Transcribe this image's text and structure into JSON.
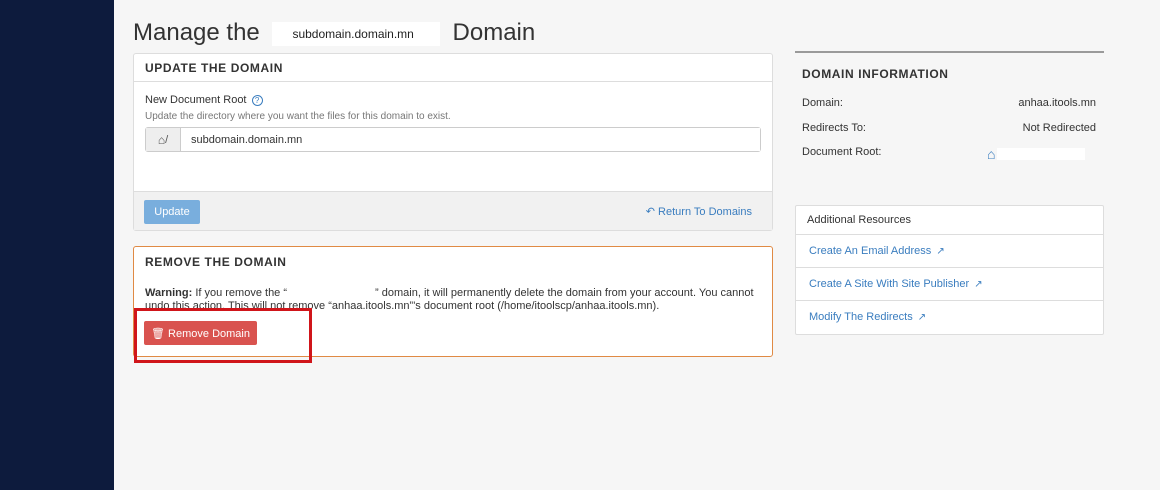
{
  "page": {
    "title_prefix": "Manage the",
    "title_domain": "subdomain.domain.mn",
    "title_suffix": "Domain"
  },
  "update_panel": {
    "heading": "UPDATE THE DOMAIN",
    "label": "New Document Root",
    "help": "Update the directory where you want the files for this domain to exist.",
    "addon": "/",
    "value": "subdomain.domain.mn",
    "update_button": "Update",
    "return_link": "Return To Domains"
  },
  "remove_panel": {
    "heading": "REMOVE THE DOMAIN",
    "warning_label": "Warning:",
    "warning_part1": "If you remove the “",
    "warning_part2": "” domain, it will permanently delete the domain from your account. You cannot undo this action. This will not remove “anhaa.itools.mn”'s document root (/home/itoolscp/anhaa.itools.mn).",
    "remove_button": "Remove Domain"
  },
  "domain_info": {
    "heading": "DOMAIN INFORMATION",
    "rows": [
      {
        "label": "Domain:",
        "value": "anhaa.itools.mn"
      },
      {
        "label": "Redirects To:",
        "value": "Not Redirected"
      },
      {
        "label": "Document Root:",
        "value": ""
      }
    ]
  },
  "resources": {
    "heading": "Additional Resources",
    "links": [
      {
        "label": "Create An Email Address"
      },
      {
        "label": "Create A Site With Site Publisher"
      },
      {
        "label": "Modify The Redirects"
      }
    ]
  },
  "icons": {
    "help": "question-circle-icon",
    "home": "home-icon",
    "return": "reply-arrow-icon",
    "trash": "trash-icon",
    "external": "external-link-icon"
  },
  "colors": {
    "sidebar": "#0d1b3d",
    "link": "#3a7dbf",
    "update_button": "#79aedd",
    "remove_button": "#d9534f",
    "remove_border": "#e08a44",
    "highlight": "#d0151a"
  }
}
